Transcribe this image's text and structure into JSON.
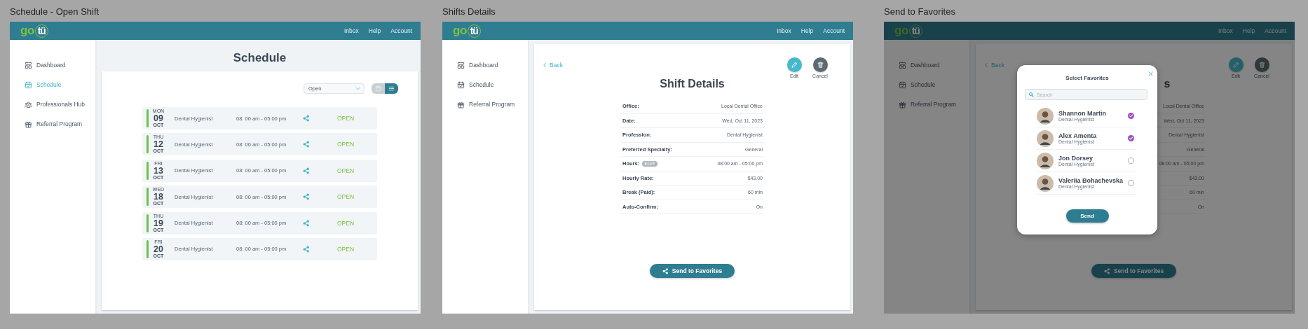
{
  "frames": [
    {
      "kind": "schedule",
      "label": "Schedule - Open Shift",
      "header": {
        "logo": {
          "lead": "go",
          "accent": "tü"
        },
        "nav": [
          "Inbox",
          "Help",
          "Account"
        ]
      },
      "sidebar": {
        "items": [
          {
            "kind": "dashboard",
            "label": "Dashboard",
            "selected": false
          },
          {
            "kind": "schedule",
            "label": "Schedule",
            "selected": true
          },
          {
            "kind": "hub",
            "label": "Professionals Hub",
            "selected": false
          },
          {
            "kind": "referral",
            "label": "Referral Program",
            "selected": false
          }
        ]
      },
      "page": {
        "title": "Schedule",
        "filter": {
          "value": "Open"
        },
        "view_toggle": [
          {
            "kind": "calendar",
            "selected": false
          },
          {
            "kind": "list",
            "selected": true
          }
        ],
        "shifts": [
          {
            "weekday": "MON",
            "day": "09",
            "month": "OCT",
            "profession": "Dental Hygienist",
            "hours": "08: 00 am - 05:00 pm",
            "status": "OPEN"
          },
          {
            "weekday": "THU",
            "day": "12",
            "month": "OCT",
            "profession": "Dental Hygienist",
            "hours": "08: 00 am - 05:00 pm",
            "status": "OPEN"
          },
          {
            "weekday": "FRI",
            "day": "13",
            "month": "OCT",
            "profession": "Dental Hygienist",
            "hours": "08: 00 am - 05:00 pm",
            "status": "OPEN"
          },
          {
            "weekday": "WED",
            "day": "18",
            "month": "OCT",
            "profession": "Dental Hygienist",
            "hours": "08: 00 am - 05:00 pm",
            "status": "OPEN"
          },
          {
            "weekday": "THU",
            "day": "19",
            "month": "OCT",
            "profession": "Dental Hygienist",
            "hours": "08: 00 am - 05:00 pm",
            "status": "OPEN"
          },
          {
            "weekday": "FRI",
            "day": "20",
            "month": "OCT",
            "profession": "Dental Hygienist",
            "hours": "08: 00 am - 05:00 pm",
            "status": "OPEN"
          }
        ]
      }
    },
    {
      "kind": "details",
      "label": "Shifts Details",
      "header": {
        "logo": {
          "lead": "go",
          "accent": "tü"
        },
        "nav": [
          "Inbox",
          "Help",
          "Account"
        ]
      },
      "sidebar": {
        "items": [
          {
            "kind": "dashboard",
            "label": "Dashboard",
            "selected": false
          },
          {
            "kind": "schedule",
            "label": "Schedule",
            "selected": false
          },
          {
            "kind": "referral",
            "label": "Referral Program",
            "selected": false
          }
        ]
      },
      "page": {
        "back": "Back",
        "actions": [
          {
            "kind": "edit",
            "label": "Edit"
          },
          {
            "kind": "cancel",
            "label": "Cancel"
          }
        ],
        "title": "Shift Details",
        "rows": [
          {
            "label": "Office:",
            "value": "Local Dental Office"
          },
          {
            "label": "Date:",
            "value": "Wed, Oct 11, 2023"
          },
          {
            "label": "Profession:",
            "value": "Dental Hygienist"
          },
          {
            "label": "Preferred Specialty:",
            "value": "General"
          },
          {
            "label": "Hours:",
            "badge": "EDIT",
            "value": "08:00 am - 05:00 pm"
          },
          {
            "label": "Hourly Rate:",
            "value": "$43.00"
          },
          {
            "label": "Break (Paid):",
            "value": "60 min"
          },
          {
            "label": "Auto-Confirm:",
            "value": "On"
          }
        ],
        "send_button": "Send to Favorites"
      }
    },
    {
      "kind": "details",
      "label": "Send to Favorites",
      "header": {
        "logo": {
          "lead": "go",
          "accent": "tü"
        },
        "nav": [
          "Inbox",
          "Help",
          "Account"
        ]
      },
      "sidebar": {
        "items": [
          {
            "kind": "dashboard",
            "label": "Dashboard",
            "selected": false
          },
          {
            "kind": "schedule",
            "label": "Schedule",
            "selected": false
          },
          {
            "kind": "referral",
            "label": "Referral Program",
            "selected": false
          }
        ]
      },
      "page": {
        "back": "Back",
        "actions": [
          {
            "kind": "edit",
            "label": "Edit"
          },
          {
            "kind": "cancel",
            "label": "Cancel"
          }
        ],
        "title": "s",
        "rows": [
          {
            "value": "Local Dental Office"
          },
          {
            "value": "Wed, Oct 11, 2023"
          },
          {
            "value": "Dental Hygienist"
          },
          {
            "value": "General"
          },
          {
            "value": "08:00 am - 05:00 pm"
          },
          {
            "value": "$43.00"
          },
          {
            "value": "60 min"
          },
          {
            "value": "On"
          }
        ],
        "send_button": "Send to Favorites"
      },
      "modal": {
        "title": "Select Favorites",
        "search": {
          "placeholder": "Search"
        },
        "favorites": [
          {
            "name": "Shannon Martin",
            "role": "Dental Hygienist",
            "selected": true
          },
          {
            "name": "Alex Amenta",
            "role": "Dental Hygienist",
            "selected": true
          },
          {
            "name": "Jon Dorsey",
            "role": "Dental Hygienist",
            "selected": false
          },
          {
            "name": "Valeriia Bohachevska",
            "role": "Dental Hygienist",
            "selected": false
          }
        ],
        "send_button": "Send"
      }
    }
  ]
}
